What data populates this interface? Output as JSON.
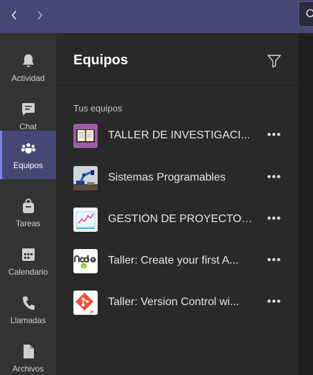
{
  "topbar": {
    "back_icon": "chevron-left-icon",
    "forward_icon": "chevron-right-icon",
    "search_icon": "search-icon",
    "color": "#464775"
  },
  "rail": {
    "items": [
      {
        "label": "Actividad",
        "icon": "bell-icon",
        "active": false
      },
      {
        "label": "Chat",
        "icon": "chat-icon",
        "active": false
      },
      {
        "label": "Equipos",
        "icon": "teams-icon",
        "active": true
      },
      {
        "label": "Tareas",
        "icon": "bag-icon",
        "active": false
      },
      {
        "label": "Calendario",
        "icon": "calendar-icon",
        "active": false
      },
      {
        "label": "Llamadas",
        "icon": "phone-icon",
        "active": false
      },
      {
        "label": "Archivos",
        "icon": "file-icon",
        "active": false
      }
    ]
  },
  "panel": {
    "title": "Equipos",
    "filter_icon": "filter-icon",
    "section_label": "Tus equipos",
    "teams": [
      {
        "name": "TALLER DE INVESTIGACI...",
        "avatar": "book-image",
        "more": "•••"
      },
      {
        "name": "Sistemas Programables",
        "avatar": "robot-arm-image",
        "more": "•••"
      },
      {
        "name": "GESTIÓN DE PROYECTOS...",
        "avatar": "chart-image",
        "more": "•••"
      },
      {
        "name": "Taller: Create your first A...",
        "avatar": "nodejs-logo-image",
        "more": "•••"
      },
      {
        "name": "Taller: Version Control wi...",
        "avatar": "git-logo-image",
        "more": "•••"
      }
    ]
  }
}
